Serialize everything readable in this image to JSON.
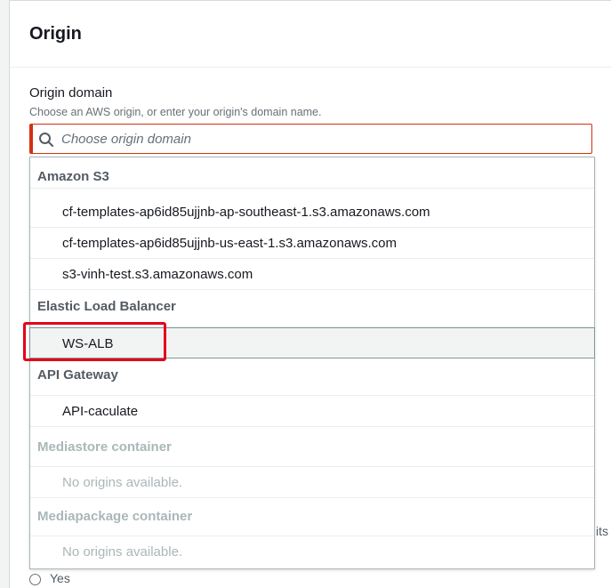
{
  "panel": {
    "title": "Origin"
  },
  "origin_domain": {
    "label": "Origin domain",
    "description": "Choose an AWS origin, or enter your origin's domain name.",
    "placeholder": "Choose origin domain",
    "value": ""
  },
  "dropdown": {
    "groups": [
      {
        "header": "Amazon S3",
        "disabled": false,
        "options": [
          "cf-templates-ap6id85ujjnb-ap-southeast-1.s3.amazonaws.com",
          "cf-templates-ap6id85ujjnb-us-east-1.s3.amazonaws.com",
          "s3-vinh-test.s3.amazonaws.com"
        ]
      },
      {
        "header": "Elastic Load Balancer",
        "disabled": false,
        "options": [
          "WS-ALB"
        ]
      },
      {
        "header": "API Gateway",
        "disabled": false,
        "options": [
          "API-caculate"
        ]
      },
      {
        "header": "Mediastore container",
        "disabled": true,
        "options": [
          "No origins available."
        ]
      },
      {
        "header": "Mediapackage container",
        "disabled": true,
        "options": [
          "No origins available."
        ]
      }
    ],
    "highlighted_option": "WS-ALB"
  },
  "clipped_text": {
    "right_edge": "its",
    "bottom_edge": "Yes"
  },
  "colors": {
    "error_border": "#d13212",
    "annotation_red": "#e3001b",
    "disabled_text": "#aab7b8",
    "group_header_text": "#545b64"
  }
}
